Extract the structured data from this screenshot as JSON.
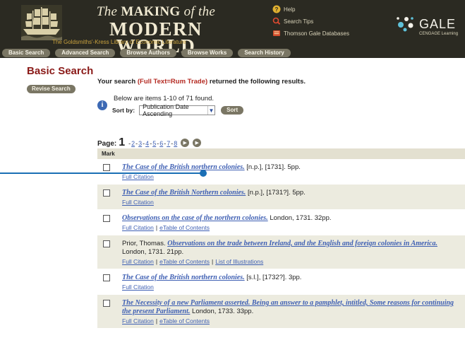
{
  "header": {
    "title_prefix": "The",
    "title_caps": "MAKING",
    "title_mid": "of the",
    "title_line2": "MODERN WORLD",
    "subtitle_lead": "The Goldsmiths'-Kress Library of Economic Literature",
    "help_links": [
      {
        "label": "Help",
        "icon": "question-icon"
      },
      {
        "label": "Search Tips",
        "icon": "search-tips-icon"
      },
      {
        "label": "Thomson Gale Databases",
        "icon": "databases-icon"
      }
    ],
    "brand": "GALE",
    "brand_sub": "CENGAGE Learning"
  },
  "nav": {
    "items": [
      "Basic Search",
      "Advanced Search",
      "Browse Authors",
      "Browse Works",
      "Search History"
    ]
  },
  "left": {
    "heading": "Basic Search",
    "revise_label": "Revise Search"
  },
  "results": {
    "intro": "Your search",
    "query": "(Full Text=Rum Trade)",
    "outro": "returned the following results.",
    "range_text": "Below are items 1-10 of 71 found.",
    "sort_label": "Sort by:",
    "sort_value": "Publication Date Ascending",
    "sort_button": "Sort",
    "pager_label": "Page:",
    "current_page": "1",
    "pages": [
      "2",
      "3",
      "4",
      "5",
      "6",
      "7",
      "8"
    ],
    "mark_header": "Mark",
    "items": [
      {
        "pre": "",
        "title": "The Case of the British northern colonies.",
        "post": " [n.p.], [1731]. 5pp.",
        "links": [
          "Full Citation"
        ],
        "shade": false
      },
      {
        "pre": "",
        "title": "The Case of the British Northern colonies.",
        "post": " [n.p.], [1731?]. 5pp.",
        "links": [
          "Full Citation"
        ],
        "shade": true
      },
      {
        "pre": "",
        "title": "Observations on the case of the northern colonies.",
        "post": " London, 1731. 32pp.",
        "links": [
          "Full Citation",
          "eTable of Contents"
        ],
        "shade": false
      },
      {
        "pre": "Prior, Thomas. ",
        "title": "Observations on the trade between Ireland, and the English and foreign colonies in America.",
        "post": " London, 1731. 21pp.",
        "links": [
          "Full Citation",
          "eTable of Contents",
          "List of Illustrations"
        ],
        "shade": true
      },
      {
        "pre": "",
        "title": "The Case of the British northern colonies.",
        "post": " [s.l.], [1732?]. 3pp.",
        "links": [
          "Full Citation"
        ],
        "shade": false
      },
      {
        "pre": "",
        "title": "The Necessity of a new Parliament asserted. Being an answer to a pamphlet, intitled, Some reasons for continuing the present Parliament.",
        "post": " London, 1733. 33pp.",
        "links": [
          "Full Citation",
          "eTable of Contents"
        ],
        "shade": true
      }
    ]
  },
  "colors": {
    "header_bg": "#2b2a22",
    "nav_button": "#7a7664",
    "heading_red": "#8a1a18",
    "link_blue": "#3e5fb3",
    "callout_blue": "#1a6fb5",
    "row_shade": "#ecebdf"
  }
}
